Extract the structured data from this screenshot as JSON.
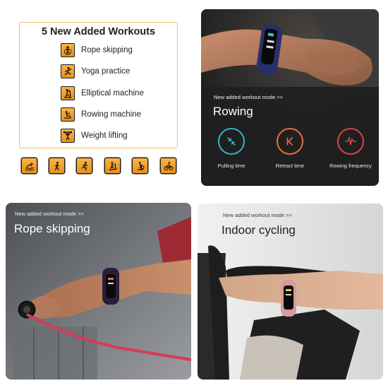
{
  "workouts_card": {
    "title": "5 New Added Workouts",
    "items": [
      {
        "label": "Rope skipping",
        "icon": "rope-skipping-icon"
      },
      {
        "label": "Yoga practice",
        "icon": "yoga-icon"
      },
      {
        "label": "Elliptical machine",
        "icon": "elliptical-icon"
      },
      {
        "label": "Rowing machine",
        "icon": "rowing-icon"
      },
      {
        "label": "Weight lifting",
        "icon": "weight-lifting-icon"
      }
    ]
  },
  "sport_icons": [
    "swimming-icon",
    "walking-icon",
    "running-icon",
    "treadmill-icon",
    "indoor-cycling-icon",
    "cycling-icon"
  ],
  "rowing_panel": {
    "subtitle": "New added workout mode >>",
    "title": "Rowing",
    "metrics": [
      {
        "label": "Pulling time",
        "color": "#2fb7c4"
      },
      {
        "label": "Retract time",
        "color": "#e8703a"
      },
      {
        "label": "Rowing frequency",
        "color": "#e0433b"
      }
    ]
  },
  "rope_panel": {
    "subtitle": "New added workout mode >>",
    "title": "Rope skipping"
  },
  "cycling_panel": {
    "subtitle": "New added workout mode >>",
    "title": "Indoor cycling"
  },
  "colors": {
    "accent_orange": "#f5a623",
    "card_border": "#f0c45a"
  }
}
